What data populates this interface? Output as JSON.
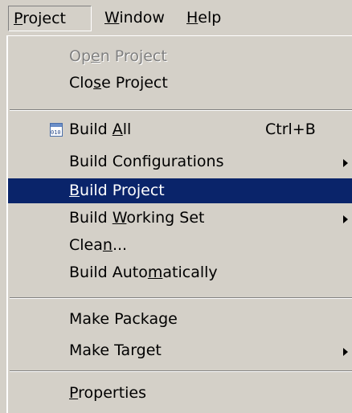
{
  "menubar": {
    "items": [
      {
        "pre": "",
        "u": "P",
        "post": "roject"
      },
      {
        "pre": "",
        "u": "W",
        "post": "indow"
      },
      {
        "pre": "",
        "u": "H",
        "post": "elp"
      }
    ]
  },
  "menu": {
    "open_project": {
      "pre": "Op",
      "u": "e",
      "post": "n Project"
    },
    "close_project": {
      "pre": "Clo",
      "u": "s",
      "post": "e Project"
    },
    "build_all": {
      "pre": "Build ",
      "u": "A",
      "post": "ll",
      "shortcut": "Ctrl+B"
    },
    "build_configurations": {
      "label": "Build Configurations"
    },
    "build_project": {
      "pre": "",
      "u": "B",
      "post": "uild Project"
    },
    "build_working_set": {
      "pre": "Build ",
      "u": "W",
      "post": "orking Set"
    },
    "clean": {
      "pre": "Clea",
      "u": "n",
      "post": "..."
    },
    "build_automatically": {
      "pre": "Build Auto",
      "u": "m",
      "post": "atically"
    },
    "make_package": {
      "label": "Make Package"
    },
    "make_target": {
      "label": "Make Target"
    },
    "properties": {
      "pre": "",
      "u": "P",
      "post": "roperties"
    }
  },
  "colors": {
    "menu_bg": "#d4d0c8",
    "selection_bg": "#0a246a",
    "selection_fg": "#ffffff",
    "disabled_fg": "#808080"
  },
  "icons": {
    "build_all": "binary-build-icon",
    "submenu": "submenu-arrow-icon"
  }
}
